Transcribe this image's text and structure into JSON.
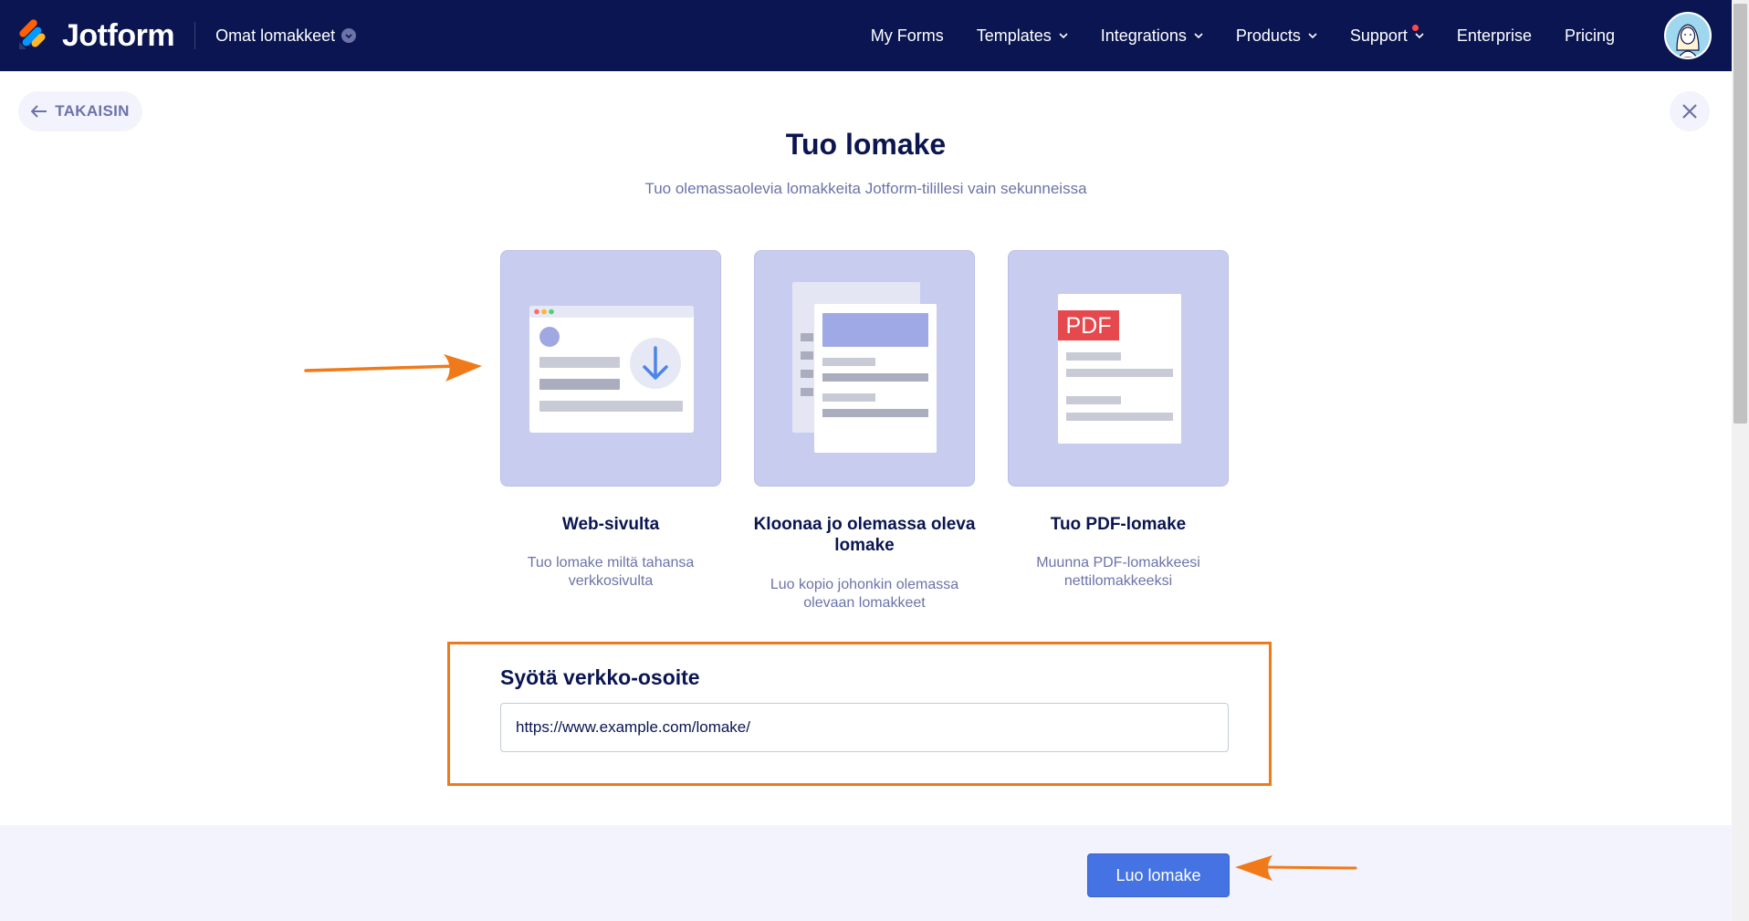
{
  "nav": {
    "brand": "Jotform",
    "my_forms": "Omat lomakkeet",
    "items": [
      "My Forms",
      "Templates",
      "Integrations",
      "Products",
      "Support",
      "Enterprise",
      "Pricing"
    ]
  },
  "page": {
    "back_label": "TAKAISIN",
    "title": "Tuo lomake",
    "subtitle": "Tuo olemassaolevia lomakkeita Jotform-tilillesi vain sekunneissa"
  },
  "options": [
    {
      "title": "Web-sivulta",
      "desc": "Tuo lomake miltä tahansa verkkosivulta"
    },
    {
      "title": "Kloonaa jo olemassa oleva lomake",
      "desc": "Luo kopio johonkin olemassa olevaan lomakkeet"
    },
    {
      "title": "Tuo PDF-lomake",
      "desc": "Muunna PDF-lomakkeesi nettilomakkeeksi",
      "badge": "PDF"
    }
  ],
  "url_section": {
    "label": "Syötä verkko-osoite",
    "value": "https://www.example.com/lomake/"
  },
  "footer": {
    "create_label": "Luo lomake"
  },
  "colors": {
    "navy": "#0a1551",
    "card_bg": "#c8cdf0",
    "accent_blue": "#4573e3",
    "highlight_orange": "#f07a1a",
    "pdf_red": "#e5484d"
  }
}
